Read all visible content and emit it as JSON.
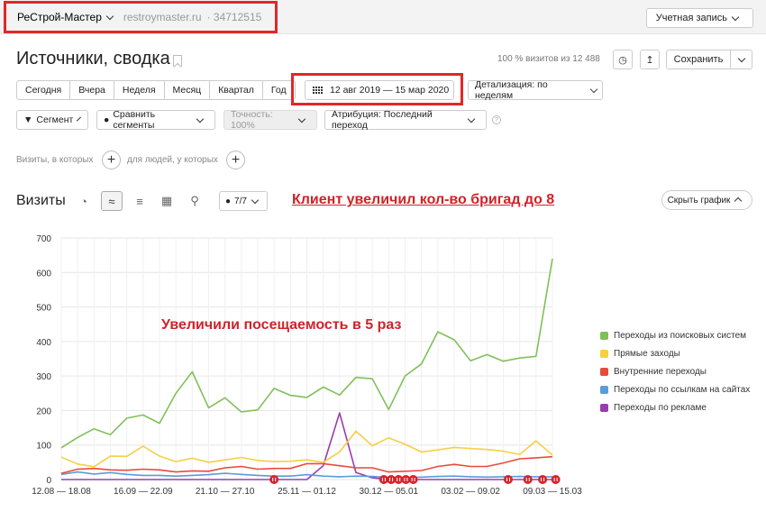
{
  "header": {
    "site_name": "РеСтрой-Мастер",
    "site_url": "restroymaster.ru",
    "counter_id": "· 34712515",
    "account_label": "Учетная запись"
  },
  "report": {
    "title": "Источники, сводка",
    "visits_share": "100 % визитов из 12 488",
    "save_label": "Сохранить"
  },
  "periods": [
    "Сегодня",
    "Вчера",
    "Неделя",
    "Месяц",
    "Квартал",
    "Год"
  ],
  "date_range": "12 авг 2019 — 15 мар 2020",
  "detail_label": "Детализация: по неделям",
  "segment_label": "Сегмент",
  "compare_label": "Сравнить сегменты",
  "accuracy_label": "Точность: 100%",
  "attribution_label": "Атрибуция: Последний переход",
  "conditions": {
    "visits_label": "Визиты, в которых",
    "people_label": "для людей, у которых"
  },
  "chart_header": {
    "metric_label": "Визиты",
    "series_count": "7/7",
    "hide_label": "Скрыть график"
  },
  "annotations": {
    "top": "Клиент увеличил кол-во бригад до 8",
    "middle": "Увеличили посещаемость в 5 раз"
  },
  "colors": {
    "accent_red": "#e2262a",
    "annotation_red": "#d0222a"
  },
  "chart_data": {
    "type": "line",
    "ylim": [
      0,
      700
    ],
    "yticks": [
      0,
      100,
      200,
      300,
      400,
      500,
      600,
      700
    ],
    "x_tick_labels": [
      {
        "i": 0,
        "label": "12.08 — 18.08"
      },
      {
        "i": 5,
        "label": "16.09 — 22.09"
      },
      {
        "i": 10,
        "label": "21.10 — 27.10"
      },
      {
        "i": 15,
        "label": "25.11 — 01.12"
      },
      {
        "i": 20,
        "label": "30.12 — 05.01"
      },
      {
        "i": 25,
        "label": "03.02 — 09.02"
      },
      {
        "i": 30,
        "label": "09.03 — 15.03"
      }
    ],
    "n_points": 31,
    "grid": true,
    "legend_position": "right",
    "series": [
      {
        "name": "Переходы из поисковых систем",
        "color": "#80c05a",
        "values": [
          92,
          122,
          147,
          130,
          178,
          187,
          163,
          250,
          312,
          208,
          237,
          196,
          202,
          264,
          244,
          238,
          268,
          245,
          296,
          292,
          203,
          300,
          335,
          428,
          405,
          344,
          362,
          343,
          352,
          357,
          640
        ]
      },
      {
        "name": "Прямые заходы",
        "color": "#f5cf45",
        "values": [
          65,
          45,
          37,
          68,
          67,
          97,
          68,
          52,
          62,
          50,
          57,
          64,
          55,
          52,
          53,
          57,
          50,
          80,
          140,
          98,
          121,
          102,
          80,
          86,
          93,
          90,
          87,
          82,
          73,
          112,
          71
        ]
      },
      {
        "name": "Внутренние переходы",
        "color": "#e84a3c",
        "values": [
          18,
          30,
          32,
          28,
          27,
          30,
          28,
          22,
          25,
          24,
          34,
          38,
          30,
          32,
          32,
          46,
          46,
          40,
          34,
          34,
          22,
          24,
          26,
          38,
          44,
          38,
          38,
          48,
          60,
          63,
          66
        ]
      },
      {
        "name": "Переходы по ссылкам на сайтах",
        "color": "#5b9bd9",
        "values": [
          15,
          22,
          16,
          20,
          15,
          12,
          12,
          10,
          12,
          14,
          18,
          15,
          12,
          10,
          10,
          14,
          10,
          8,
          10,
          9,
          6,
          5,
          7,
          9,
          10,
          8,
          7,
          8,
          9,
          8,
          8
        ]
      },
      {
        "name": "Переходы по рекламе",
        "color": "#9b3bb0",
        "values": [
          0,
          0,
          0,
          0,
          0,
          0,
          0,
          0,
          0,
          0,
          0,
          0,
          0,
          0,
          0,
          0,
          40,
          193,
          20,
          5,
          0,
          0,
          0,
          0,
          0,
          0,
          0,
          0,
          0,
          0,
          0
        ]
      }
    ],
    "event_markers": [
      13.0,
      19.7,
      20.15,
      20.6,
      21.05,
      21.5,
      27.3,
      28.5,
      29.4,
      30.2
    ]
  }
}
